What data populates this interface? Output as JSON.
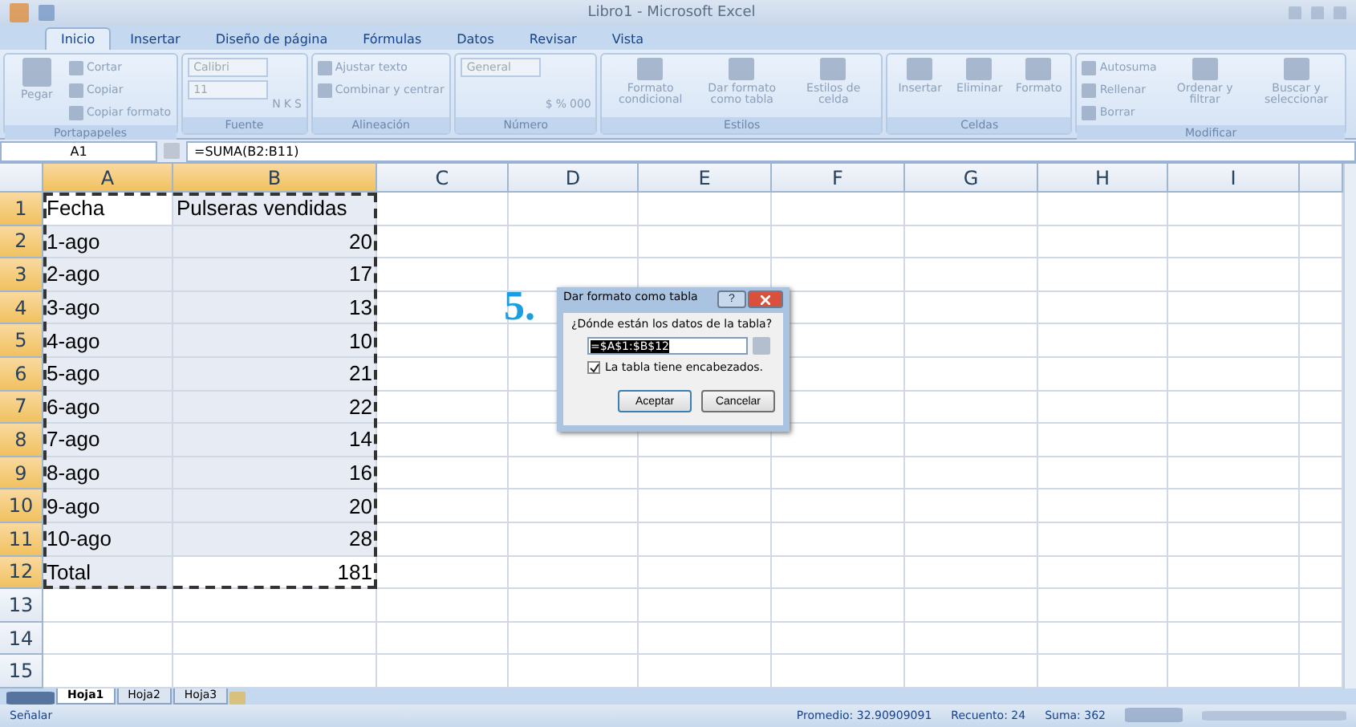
{
  "window": {
    "title": "Libro1 - Microsoft Excel"
  },
  "tabs": [
    {
      "label": "Inicio",
      "selected": true
    },
    {
      "label": "Insertar",
      "selected": false
    },
    {
      "label": "Diseño de página",
      "selected": false
    },
    {
      "label": "Fórmulas",
      "selected": false
    },
    {
      "label": "Datos",
      "selected": false
    },
    {
      "label": "Revisar",
      "selected": false
    },
    {
      "label": "Vista",
      "selected": false
    }
  ],
  "ribbon": {
    "groups": [
      {
        "label": "Portapapeles",
        "big": [
          {
            "label": "Pegar"
          }
        ],
        "small": [
          {
            "label": "Cortar"
          },
          {
            "label": "Copiar"
          },
          {
            "label": "Copiar formato"
          }
        ]
      },
      {
        "label": "Fuente",
        "fields": [
          {
            "value": "Calibri"
          },
          {
            "value": "11"
          }
        ],
        "small": [
          {
            "label": "N"
          },
          {
            "label": "K"
          },
          {
            "label": "S"
          }
        ]
      },
      {
        "label": "Alineación",
        "small": [
          {
            "label": "Ajustar texto"
          },
          {
            "label": "Combinar y centrar"
          }
        ]
      },
      {
        "label": "Número",
        "fields": [
          {
            "value": "General"
          }
        ],
        "small": [
          {
            "label": "$"
          },
          {
            "label": "%"
          },
          {
            "label": "000"
          }
        ]
      },
      {
        "label": "Estilos",
        "big": [
          {
            "label": "Formato condicional"
          },
          {
            "label": "Dar formato como tabla"
          },
          {
            "label": "Estilos de celda"
          }
        ]
      },
      {
        "label": "Celdas",
        "big": [
          {
            "label": "Insertar"
          },
          {
            "label": "Eliminar"
          },
          {
            "label": "Formato"
          }
        ]
      },
      {
        "label": "Modificar",
        "small": [
          {
            "label": "Autosuma"
          },
          {
            "label": "Rellenar"
          },
          {
            "label": "Borrar"
          }
        ],
        "big": [
          {
            "label": "Ordenar y filtrar"
          },
          {
            "label": "Buscar y seleccionar"
          }
        ]
      }
    ]
  },
  "formula_bar": {
    "name_box": "A1",
    "formula": "=SUMA(B2:B11)"
  },
  "columns": [
    {
      "label": "A",
      "selected": true
    },
    {
      "label": "B",
      "selected": true
    },
    {
      "label": "C",
      "selected": false
    },
    {
      "label": "D",
      "selected": false
    },
    {
      "label": "E",
      "selected": false
    },
    {
      "label": "F",
      "selected": false
    },
    {
      "label": "G",
      "selected": false
    },
    {
      "label": "H",
      "selected": false
    },
    {
      "label": "I",
      "selected": false
    }
  ],
  "rows": [
    {
      "label": "1",
      "selected": true,
      "cells": [
        {
          "text": "Fecha",
          "selected": false
        },
        {
          "text": "Pulseras vendidas",
          "selected": true
        }
      ]
    },
    {
      "label": "2",
      "selected": true,
      "cells": [
        {
          "text": "1-ago",
          "selected": true
        },
        {
          "text": "20",
          "selected": true
        }
      ]
    },
    {
      "label": "3",
      "selected": true,
      "cells": [
        {
          "text": "2-ago",
          "selected": true
        },
        {
          "text": "17",
          "selected": true
        }
      ]
    },
    {
      "label": "4",
      "selected": true,
      "cells": [
        {
          "text": "3-ago",
          "selected": true
        },
        {
          "text": "13",
          "selected": true
        }
      ]
    },
    {
      "label": "5",
      "selected": true,
      "cells": [
        {
          "text": "4-ago",
          "selected": true
        },
        {
          "text": "10",
          "selected": true
        }
      ]
    },
    {
      "label": "6",
      "selected": true,
      "cells": [
        {
          "text": "5-ago",
          "selected": true
        },
        {
          "text": "21",
          "selected": true
        }
      ]
    },
    {
      "label": "7",
      "selected": true,
      "cells": [
        {
          "text": "6-ago",
          "selected": true
        },
        {
          "text": "22",
          "selected": true
        }
      ]
    },
    {
      "label": "8",
      "selected": true,
      "cells": [
        {
          "text": "7-ago",
          "selected": true
        },
        {
          "text": "14",
          "selected": true
        }
      ]
    },
    {
      "label": "9",
      "selected": true,
      "cells": [
        {
          "text": "8-ago",
          "selected": true
        },
        {
          "text": "16",
          "selected": true
        }
      ]
    },
    {
      "label": "10",
      "selected": true,
      "cells": [
        {
          "text": "9-ago",
          "selected": true
        },
        {
          "text": "20",
          "selected": true
        }
      ]
    },
    {
      "label": "11",
      "selected": true,
      "cells": [
        {
          "text": "10-ago",
          "selected": true
        },
        {
          "text": "28",
          "selected": true
        }
      ]
    },
    {
      "label": "12",
      "selected": true,
      "cells": [
        {
          "text": "Total",
          "selected": true
        },
        {
          "text": "181",
          "selected": false
        }
      ]
    },
    {
      "label": "13",
      "selected": false,
      "cells": []
    },
    {
      "label": "14",
      "selected": false,
      "cells": []
    },
    {
      "label": "15",
      "selected": false,
      "cells": []
    }
  ],
  "step_label": "5.",
  "dialog": {
    "title": "Dar formato como tabla",
    "help": "?",
    "question": "¿Dónde están los datos de la tabla?",
    "range": "=$A$1:$B$12",
    "checkbox": {
      "label": "La tabla tiene encabezados.",
      "checked": true
    },
    "buttons": [
      "Aceptar",
      "Cancelar"
    ]
  },
  "sheets": [
    {
      "label": "Hoja1",
      "selected": true
    },
    {
      "label": "Hoja2",
      "selected": false
    },
    {
      "label": "Hoja3",
      "selected": false
    }
  ],
  "status_bar": {
    "mode": "Señalar",
    "stats": [
      "Promedio: 32.90909091",
      "Recuento: 24",
      "Suma: 362"
    ]
  }
}
